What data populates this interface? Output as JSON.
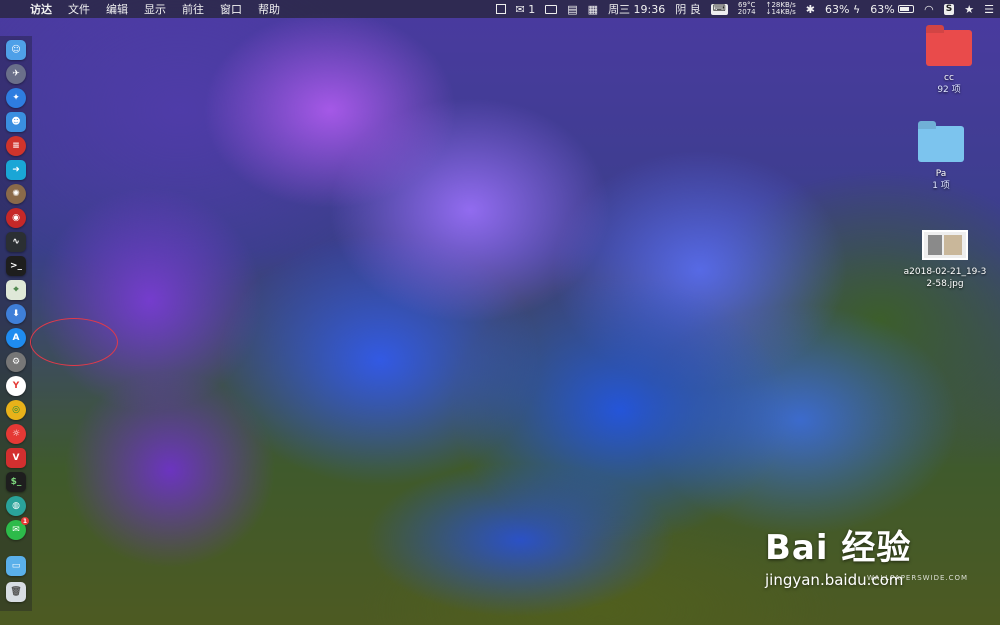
{
  "menubar": {
    "app_name": "访达",
    "menus": [
      "文件",
      "编辑",
      "显示",
      "前往",
      "窗口",
      "帮助"
    ],
    "wechat_count": "1",
    "datetime": "周三 19:36",
    "weather": "阴 良",
    "temp_top": "69°C",
    "temp_bottom": "2074",
    "net_up": "↑28KB/s",
    "net_down": "↓14KB/s",
    "cpu": "63%",
    "battery": "63%"
  },
  "desktop": {
    "items": [
      {
        "name": "cc",
        "sub": "92 项"
      },
      {
        "name": "Pa",
        "sub": "1 项"
      },
      {
        "name": "a2018-02-21_19-3",
        "name2": "2-58.jpg"
      }
    ]
  },
  "watermark": {
    "logo": "Bai 经验",
    "url": "jingyan.baidu.com",
    "small": "WALLPAPERSWIDE.COM"
  },
  "dock": {
    "badge": "1"
  }
}
